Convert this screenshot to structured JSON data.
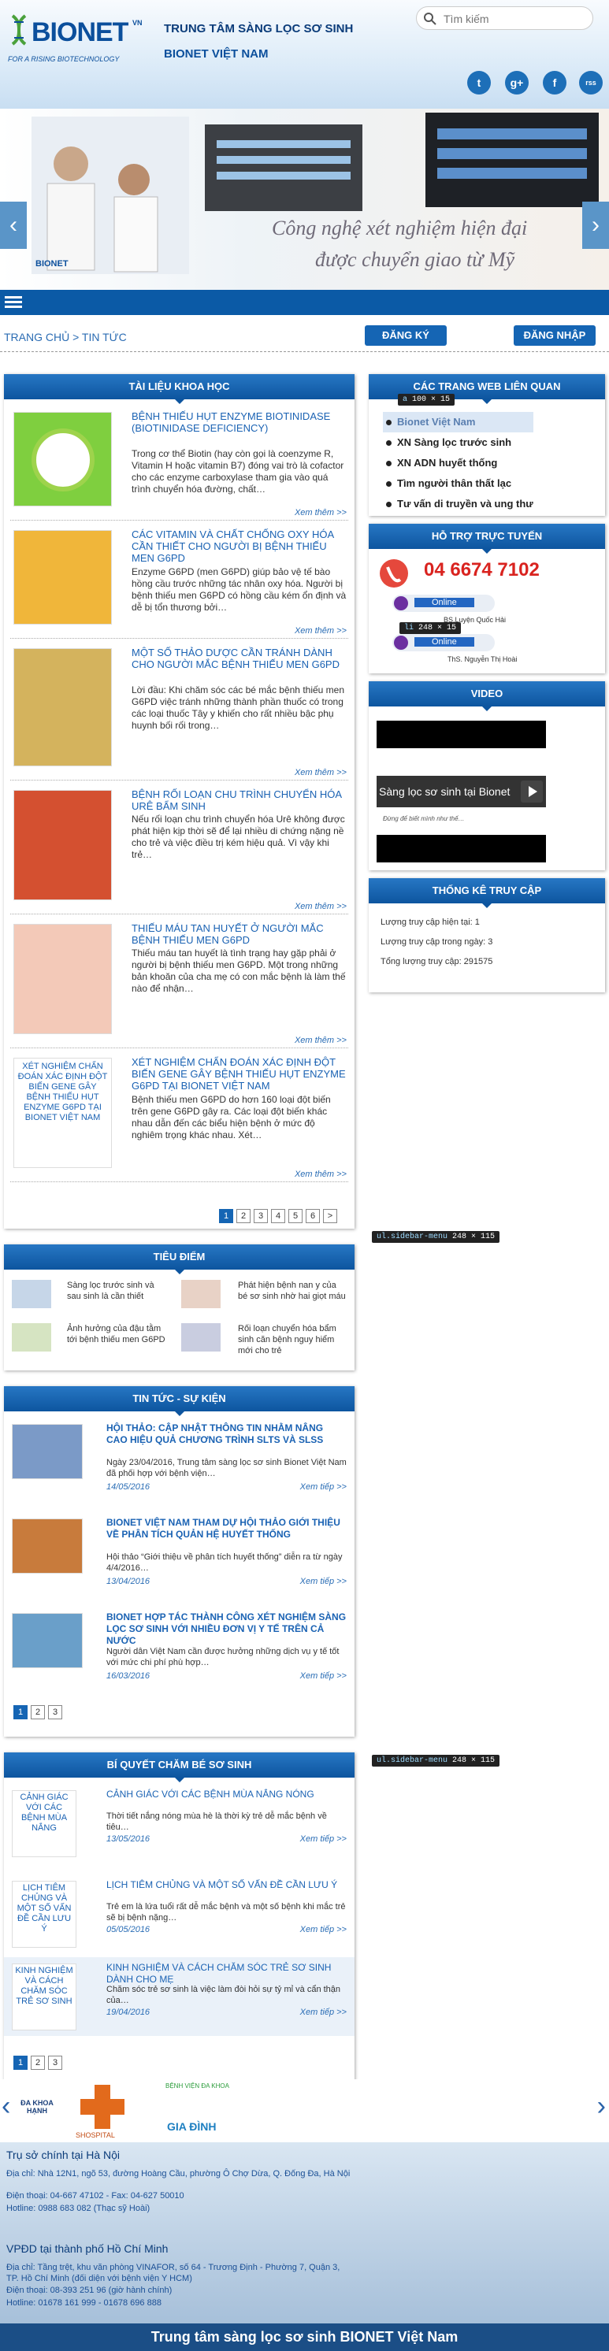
{
  "header": {
    "logo_text": "BIONET",
    "logo_sup": "VN",
    "logo_tag": "FOR A RISING BIOTECHNOLOGY",
    "title": "TRUNG TÂM SÀNG LỌC SƠ SINH",
    "subtitle": "BIONET VIỆT NAM",
    "search_placeholder": "Tìm kiếm",
    "social": [
      "t",
      "g+",
      "f",
      "rss"
    ]
  },
  "banner": {
    "slogan_line1": "Công nghệ xét nghiệm hiện đại",
    "slogan_line2": "được chuyển giao từ Mỹ",
    "logo": "BIONET",
    "prev": "‹",
    "next": "›"
  },
  "nav": {
    "breadcrumb": "TRANG CHỦ > TIN TỨC",
    "register": "ĐĂNG KÝ",
    "login": "ĐĂNG NHẬP"
  },
  "science": {
    "heading": "TÀI LIỆU KHOA HỌC",
    "more_label": "Xem thêm >>",
    "articles": [
      {
        "title": "BỆNH THIẾU HỤT ENZYME BIOTINIDASE (BIOTINIDASE DEFICIENCY)",
        "desc": "Trong cơ thể Biotin (hay còn gọi là coenzyme R, Vitamin H hoặc vitamin B7) đóng vai trò là cofactor cho các enzyme carboxylase tham gia vào quá trình chuyển hóa đường, chất…",
        "thumb": "b7"
      },
      {
        "title": "CÁC VITAMIN VÀ CHẤT CHỐNG OXY HÓA CẦN THIẾT CHO NGƯỜI BỊ BỆNH THIẾU MEN G6PD",
        "desc": "Enzyme G6PD (men G6PD) giúp bảo vệ tế bào hồng cầu trước những tác nhân oxy hóa. Người bị bệnh thiếu men G6PD có hồng cầu kém ổn định và dễ bị tổn thương bởi…",
        "thumb": "fruit"
      },
      {
        "title": "MỘT SỐ THẢO DƯỢC CẦN TRÁNH DÀNH CHO NGƯỜI MẮC BỆNH THIẾU MEN G6PD",
        "desc": "Lời đầu: Khi chăm sóc các bé mắc bệnh thiếu men G6PD việc tránh những thành phần thuốc có trong các loại thuốc Tây y khiến cho rất nhiều bậc phụ huynh bối rối trong…",
        "thumb": "herb"
      },
      {
        "title": "BỆNH RỐI LOẠN CHU TRÌNH CHUYỂN HÓA URÊ BẨM SINH",
        "desc": "Nếu rối loạn chu trình chuyển hóa Urê không được phát hiện kịp thời sẽ để lại nhiều di chứng nặng nề cho trẻ và việc điều trị kém hiệu quả. Vì vậy khi trẻ…",
        "thumb": "food"
      },
      {
        "title": "THIẾU MÁU TAN HUYẾT Ở NGƯỜI MẮC BỆNH THIẾU MEN G6PD",
        "desc": "Thiếu máu tan huyết là tình trạng hay gặp phải ở người bị bệnh thiếu men G6PD. Một trong những bản khoăn của cha mẹ có con mắc bệnh là làm thế nào để nhận…",
        "thumb": "baby"
      },
      {
        "title": "XÉT NGHIỆM CHẨN ĐOÁN XÁC ĐỊNH ĐỘT BIẾN GENE GÂY BỆNH THIẾU HỤT ENZYME G6PD TẠI BIONET VIỆT NAM",
        "desc": "Bệnh thiếu men G6PD do hơn 160 loại đột biến trên gene G6PD gây ra. Các loại đột biến khác nhau dẫn đến các biểu hiện bệnh ở mức độ nghiêm trọng khác nhau. Xét…",
        "thumb": "alt",
        "thumb_alt": "XÉT NGHIỆM CHẨN ĐOÁN XÁC ĐỊNH ĐỘT BIẾN GENE GÂY BỆNH THIẾU HỤT ENZYME G6PD TẠI BIONET VIỆT NAM"
      }
    ],
    "pages": [
      "1",
      "2",
      "3",
      "4",
      "5",
      "6",
      ">"
    ]
  },
  "focus": {
    "heading": "TIÊU ĐIỂM",
    "items": [
      "Sàng lọc trước sinh và sau sinh là cần thiết",
      "Phát hiện bệnh nan y của bé sơ sinh nhờ hai giọt máu",
      "Ảnh hưởng của đậu tằm tới bệnh thiếu men G6PD",
      "Rối loạn chuyển hóa bẩm sinh căn bệnh nguy hiểm mới cho trẻ"
    ]
  },
  "news": {
    "heading": "TIN TỨC - SỰ KIỆN",
    "more_label": "Xem tiếp >>",
    "articles": [
      {
        "title": "HỘI THẢO: CẬP NHẬT THÔNG TIN NHẰM NÂNG CAO HIỆU QUẢ CHƯƠNG TRÌNH SLTS VÀ SLSS",
        "desc": "Ngày 23/04/2016, Trung tâm sàng lọc sơ sinh Bionet Việt Nam đã phối hợp với bệnh viện…",
        "date": "14/05/2016"
      },
      {
        "title": "BIONET VIỆT NAM THAM DỰ HỘI THẢO GIỚI THIỆU VỀ PHÂN TÍCH QUẢN HỆ HUYẾT THỐNG",
        "desc": "Hội thảo “Giới thiệu về phân tích huyết thống” diễn ra từ ngày 4/4/2016…",
        "date": "13/04/2016"
      },
      {
        "title": "BIONET HỢP TÁC THÀNH CÔNG XÉT NGHIỆM SÀNG LỌC SƠ SINH VỚI NHIỀU ĐƠN VỊ Y TẾ TRÊN CẢ NƯỚC",
        "desc": "Người dân Việt Nam cần được hưởng những dịch vụ y tế tốt với mức chi phí phù hợp…",
        "date": "16/03/2016"
      }
    ],
    "pages": [
      "1",
      "2",
      "3"
    ]
  },
  "care": {
    "heading": "BÍ QUYẾT CHĂM BÉ SƠ SINH",
    "more_label": "Xem tiếp >>",
    "articles": [
      {
        "title": "CẢNH GIÁC VỚI CÁC BỆNH MÙA NẮNG NÓNG",
        "desc": "Thời tiết nắng nóng mùa hè là thời kỳ  trẻ dễ mắc bệnh về tiêu…",
        "date": "13/05/2016",
        "thumb_alt": "CẢNH GIÁC VỚI CÁC BỆNH MÙA NẮNG"
      },
      {
        "title": "LỊCH TIÊM CHỦNG VÀ MỘT SỐ VẤN ĐỀ CẦN LƯU Ý",
        "desc": "Trẻ em là lứa tuổi rất dễ mắc bệnh và một số bệnh khi mắc trẻ sẽ bị bệnh nặng…",
        "date": "05/05/2016",
        "thumb_alt": "LỊCH TIÊM CHỦNG VÀ MỘT SỐ VẤN ĐỀ CẦN LƯU Ý"
      },
      {
        "title": "KINH NGHIỆM VÀ CÁCH CHĂM SÓC TRẺ SƠ SINH DÀNH CHO MẸ",
        "desc": "Chăm sóc trẻ sơ sinh là việc làm đòi hỏi sự tỷ mỉ và cẩn thận của…",
        "date": "19/04/2016",
        "thumb_alt": "KINH NGHIỆM VÀ CÁCH CHĂM SÓC TRẺ SƠ SINH"
      }
    ],
    "pages": [
      "1",
      "2",
      "3"
    ]
  },
  "sidebar": {
    "links_heading": "CÁC TRANG WEB LIÊN QUAN",
    "links": [
      "Bionet Việt Nam",
      "XN Sàng lọc trước sinh",
      "XN ADN huyết thống",
      "Tìm người thân thất lạc",
      "Tư vấn di truyền và ung thư"
    ],
    "support_heading": "HỖ TRỢ TRỰC TUYẾN",
    "hotline": "04 6674 7102",
    "online1": "Online",
    "online1_name": "BS.Luyện Quốc Hải",
    "online2": "Online",
    "online2_name": "ThS. Nguyễn Thị Hoài",
    "video_heading": "VIDEO",
    "video_title": "Sàng lọc sơ sinh tại Bionet",
    "video_caption": "Đừng để biết mình như thế…",
    "stats_heading": "THỐNG KÊ TRUY CẬP",
    "stats": [
      "Lượng truy cập hiện tại: 1",
      "Lượng truy cập trong ngày: 3",
      "Tổng lượng truy cập: 291575"
    ]
  },
  "devtools": {
    "tip1_tag": "a",
    "tip1_size": "100 × 15",
    "tip2_tag": "li",
    "tip2_size": "248 × 15",
    "tip3_tag": "ul.sidebar-menu",
    "tip3_size": "248 × 115",
    "tip4_tag": "ul.sidebar-menu",
    "tip4_size": "248 × 115"
  },
  "partners": {
    "p1": "ĐA KHOA\nHẠNH",
    "p2": "SHOSPITAL",
    "p3_top": "BỆNH VIỆN ĐA KHOA",
    "p3": "GIA ĐÌNH"
  },
  "footer": {
    "hn_heading": "Trụ sở chính tại Hà Nội",
    "hn_lines": [
      "Địa chỉ: Nhà 12N1, ngõ 53, đường Hoàng Cầu, phường Ô Chợ Dừa, Q. Đống Đa, Hà Nội",
      "Điện thoại: 04-667 47102 - Fax: 04-627 50010",
      "Hotline: 0988 683 082 (Thạc sỹ Hoài)"
    ],
    "hcm_heading": "VPĐD tại thành phố Hồ Chí Minh",
    "hcm_lines": [
      "Địa chỉ: Tầng trệt, khu văn phòng VINAFOR, số 64 - Trương Định - Phường 7, Quận 3, TP. Hồ Chí Minh (đối diện với bệnh viện Y HCM)",
      "Điện thoại: 08-393 251 96 (giờ hành chính)",
      "Hotline: 01678 161 999 - 01678 696 888"
    ],
    "bottom": "Trung tâm sàng lọc sơ sinh BIONET Việt Nam"
  },
  "colors": {
    "primary": "#1565b4",
    "header_blue": "#0b4f9c",
    "link": "#1a62b3"
  }
}
